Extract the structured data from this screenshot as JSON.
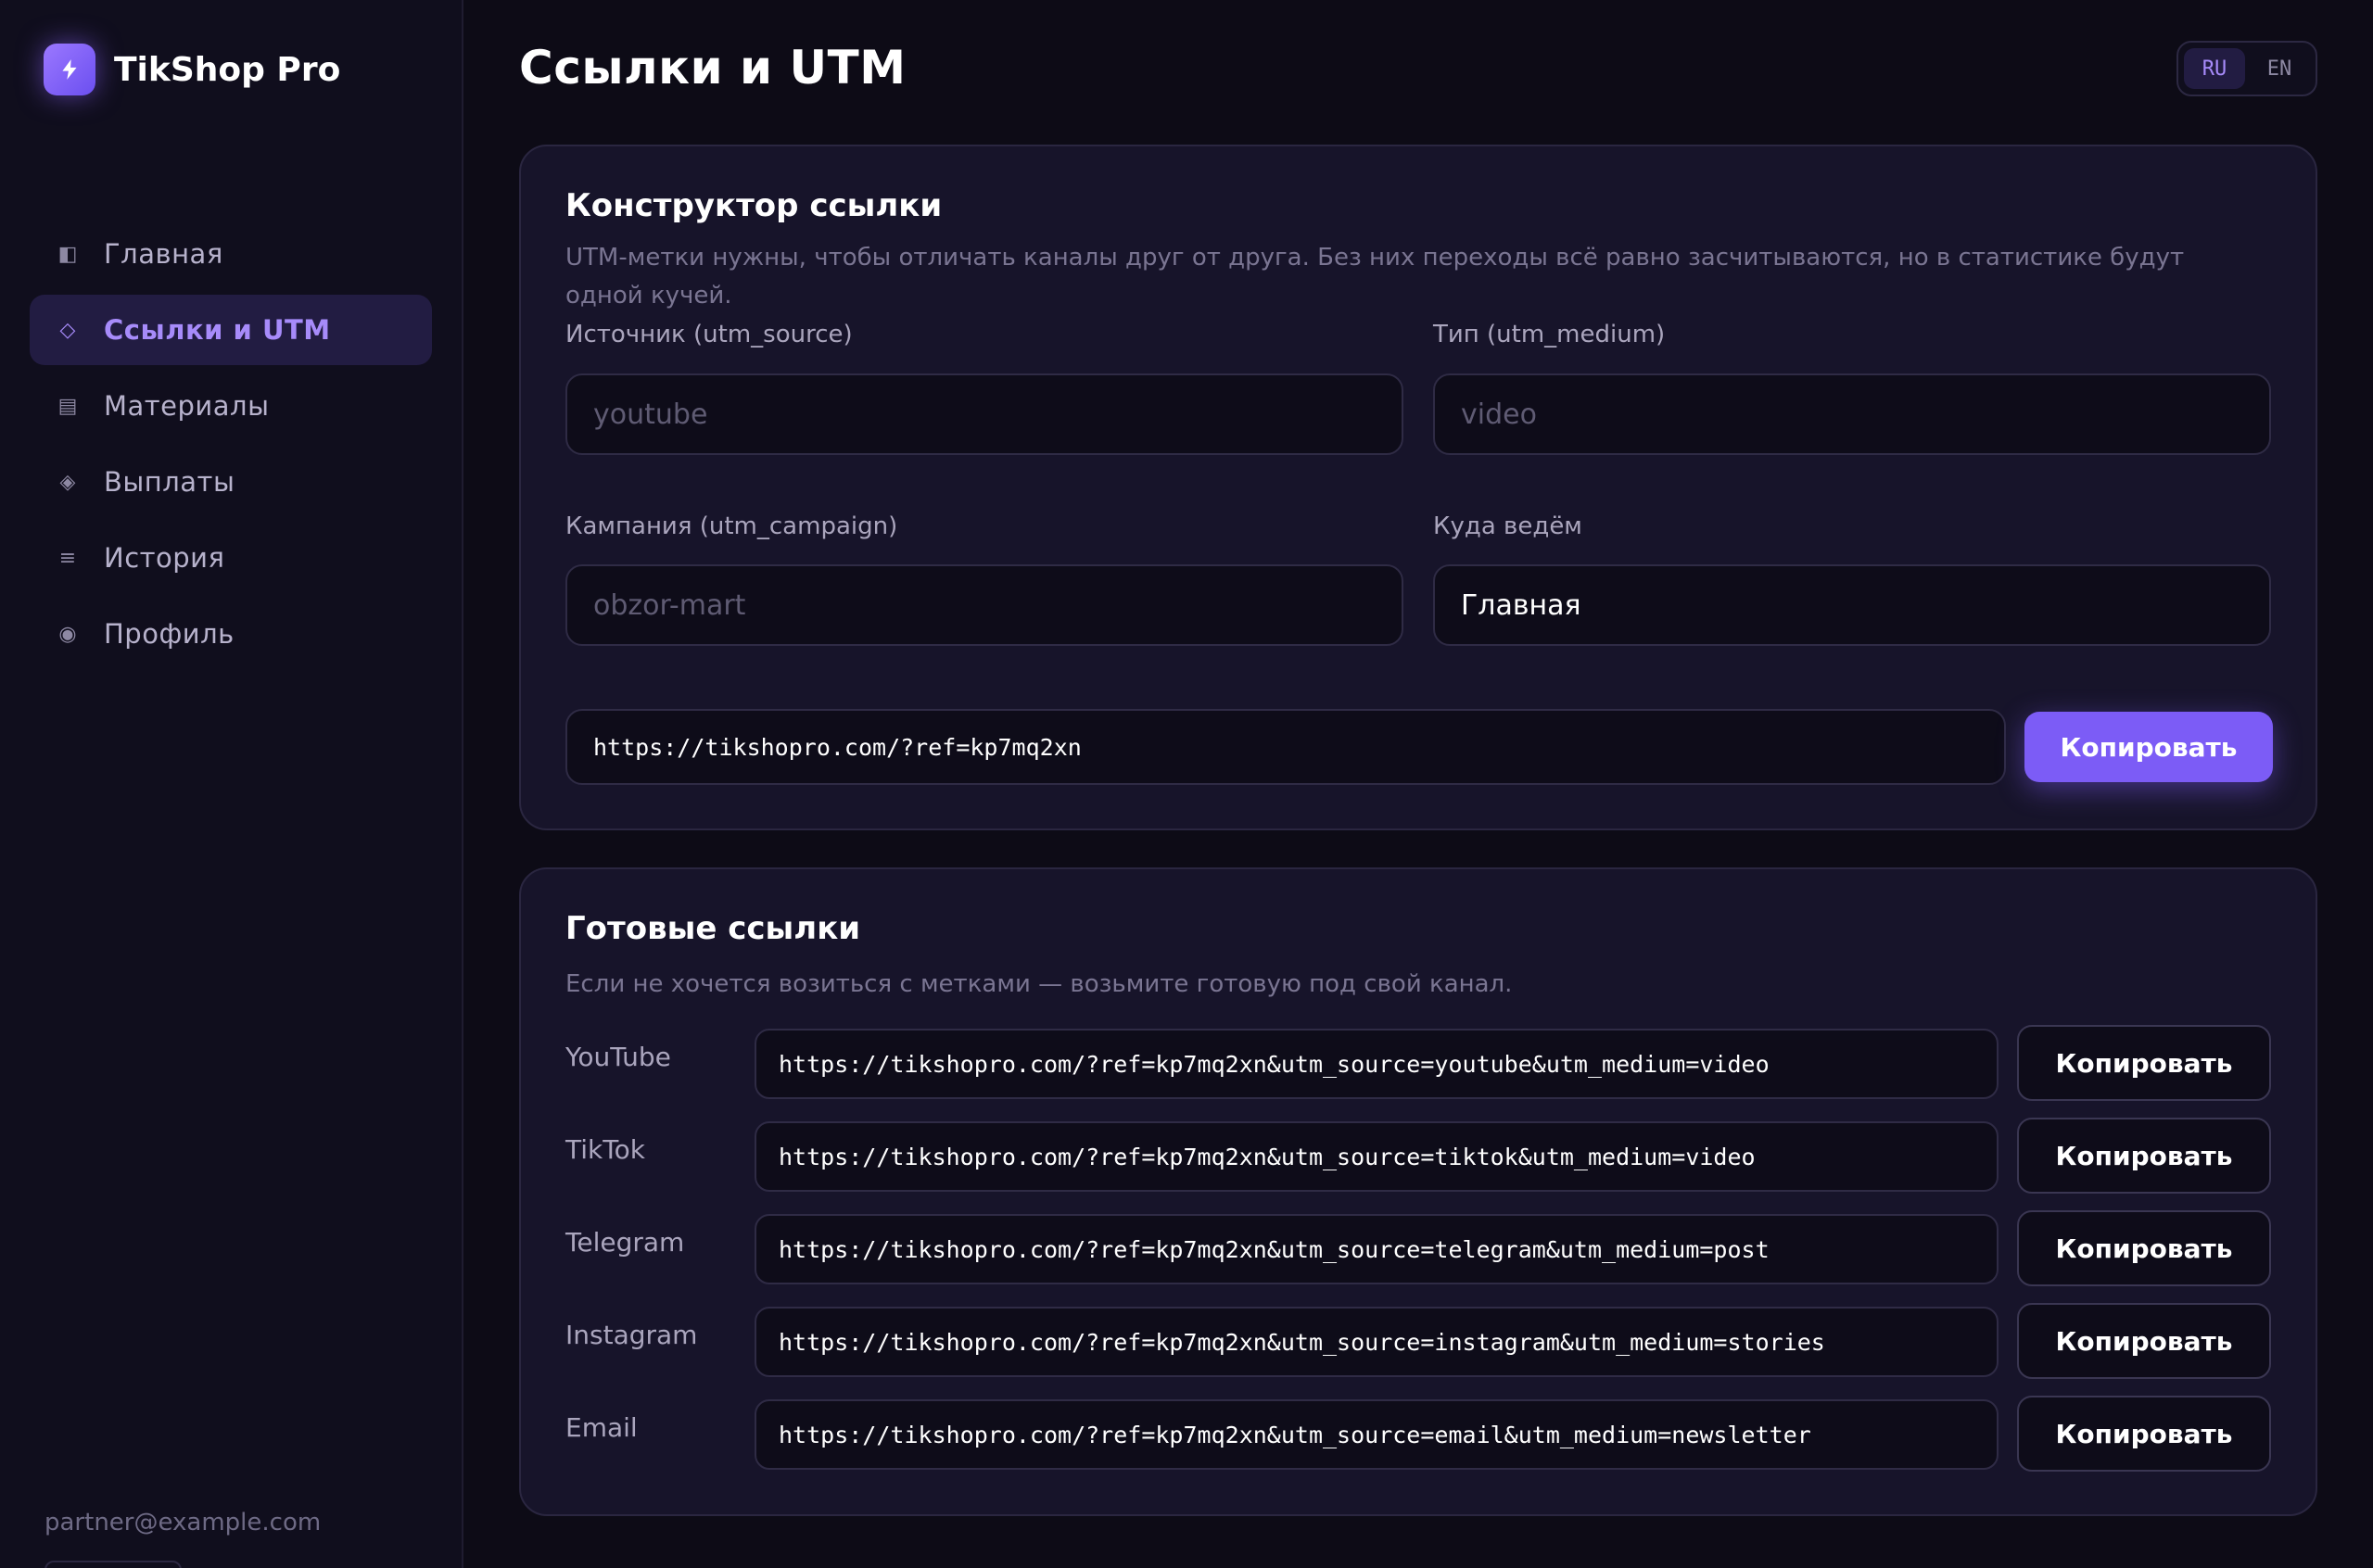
{
  "sidebar": {
    "brand_name": "TikShop Pro",
    "brand_icon": "lightning-icon",
    "items": [
      {
        "label": "Главная",
        "icon": "◧"
      },
      {
        "label": "Ссылки и UTM",
        "icon": "◇",
        "active": true
      },
      {
        "label": "Материалы",
        "icon": "▤"
      },
      {
        "label": "Выплаты",
        "icon": "◈"
      },
      {
        "label": "История",
        "icon": "≡"
      },
      {
        "label": "Профиль",
        "icon": "◉"
      }
    ],
    "email": "partner@example.com"
  },
  "header": {
    "title": "Ссылки и UTM",
    "lang": {
      "ru": "RU",
      "en": "EN",
      "active": "RU"
    }
  },
  "builder": {
    "title": "Конструктор ссылки",
    "desc_line1": "UTM-метки нужны, чтобы отличать каналы друг от друга. Без них переходы всё равно засчитываются, но в статистике будут",
    "desc_line2": "одной кучей.",
    "source": {
      "label": "Источник (utm_source)",
      "placeholder": "youtube",
      "value": ""
    },
    "medium": {
      "label": "Тип (utm_medium)",
      "placeholder": "video",
      "value": ""
    },
    "campaign": {
      "label": "Кампания (utm_campaign)",
      "placeholder": "obzor-mart",
      "value": ""
    },
    "target": {
      "label": "Куда ведём",
      "selected": "Главная"
    },
    "url": "https://tikshopro.com/?ref=kp7mq2xn",
    "copy_label": "Копировать"
  },
  "ready": {
    "title": "Готовые ссылки",
    "desc": "Если не хочется возиться с метками — возьмите готовую под свой канал.",
    "rows": [
      {
        "name": "YouTube",
        "url": "https://tikshopro.com/?ref=kp7mq2xn&utm_source=youtube&utm_medium=video",
        "copy": "Копировать"
      },
      {
        "name": "TikTok",
        "url": "https://tikshopro.com/?ref=kp7mq2xn&utm_source=tiktok&utm_medium=video",
        "copy": "Копировать"
      },
      {
        "name": "Telegram",
        "url": "https://tikshopro.com/?ref=kp7mq2xn&utm_source=telegram&utm_medium=post",
        "copy": "Копировать"
      },
      {
        "name": "Instagram",
        "url": "https://tikshopro.com/?ref=kp7mq2xn&utm_source=instagram&utm_medium=stories",
        "copy": "Копировать"
      },
      {
        "name": "Email",
        "url": "https://tikshopro.com/?ref=kp7mq2xn&utm_source=email&utm_medium=newsletter",
        "copy": "Копировать"
      }
    ]
  },
  "colors": {
    "background": "#0d0b16",
    "sidebar": "#100e1d",
    "card": "#17142a",
    "accent": "#7c5cf6",
    "accent_light": "#a78bfa"
  }
}
